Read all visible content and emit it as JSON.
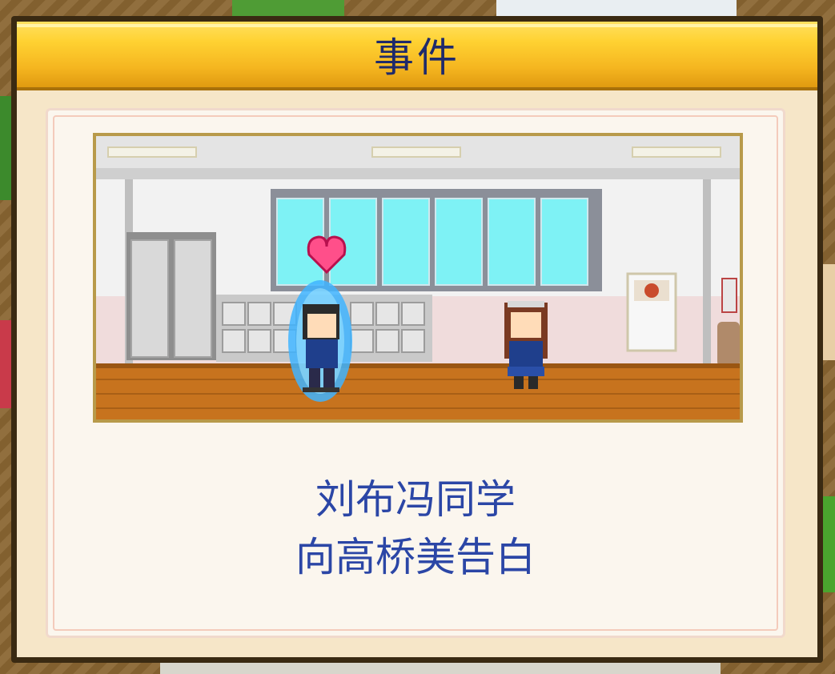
{
  "dialog": {
    "title": "事件",
    "message_line1": "刘布冯同学",
    "message_line2": "向高桥美告白"
  },
  "scene": {
    "description_icons": [
      "heart-icon",
      "boy-student",
      "girl-student",
      "lockers",
      "windows",
      "bulletin-board"
    ]
  },
  "colors": {
    "title_text": "#1f2a6b",
    "message_text": "#2b46a6",
    "title_bar": "#ffd232",
    "aura": "#3fb4ff",
    "heart": "#ff4f8a"
  }
}
